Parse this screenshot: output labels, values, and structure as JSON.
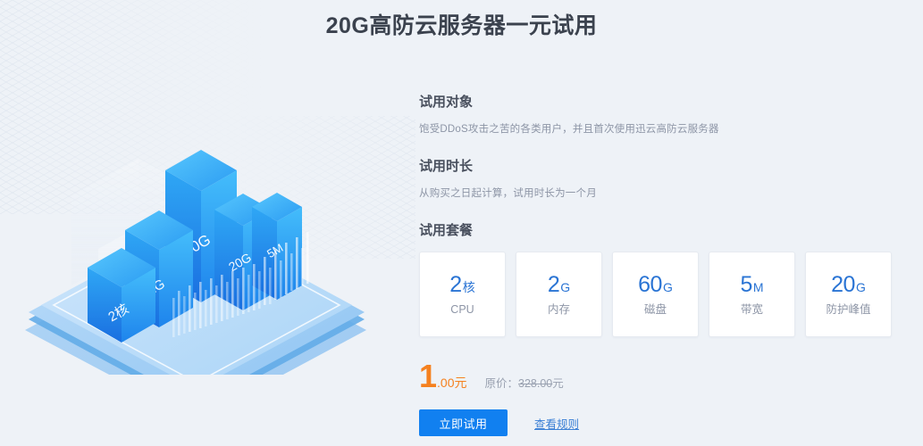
{
  "page": {
    "title": "20G高防云服务器一元试用",
    "background_color": "#eef2f7",
    "accent_blue": "#2a74d4",
    "button_blue": "#1180f0",
    "price_orange": "#f5811f"
  },
  "sections": {
    "audience": {
      "heading": "试用对象",
      "description": "饱受DDoS攻击之苦的各类用户，并且首次使用迅云高防云服务器"
    },
    "duration": {
      "heading": "试用时长",
      "description": "从购买之日起计算，试用时长为一个月"
    },
    "package": {
      "heading": "试用套餐",
      "specs": [
        {
          "number": "2",
          "unit": "核",
          "label": "CPU"
        },
        {
          "number": "2",
          "unit": "G",
          "label": "内存"
        },
        {
          "number": "60",
          "unit": "G",
          "label": "磁盘"
        },
        {
          "number": "5",
          "unit": "M",
          "label": "带宽"
        },
        {
          "number": "20",
          "unit": "G",
          "label": "防护峰值"
        }
      ]
    }
  },
  "price": {
    "amount": "1",
    "decimals": ".00元",
    "original_prefix": "原价：",
    "original_value": "328.00",
    "original_suffix": "元"
  },
  "actions": {
    "primary_label": "立即试用",
    "rules_link_label": "查看规则"
  },
  "illustration": {
    "name": "isometric-3d-bar-chart",
    "bars": [
      {
        "label": "2核",
        "height_rank": 1
      },
      {
        "label": "2G",
        "height_rank": 2
      },
      {
        "label": "60G",
        "height_rank": 5
      },
      {
        "label": "20G",
        "height_rank": 4
      },
      {
        "label": "5M",
        "height_rank": 3
      }
    ]
  }
}
